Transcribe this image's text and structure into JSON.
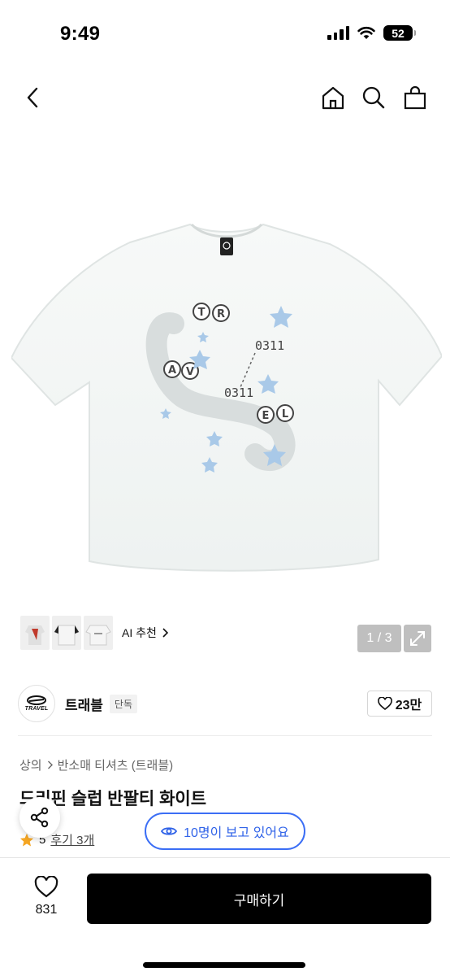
{
  "status_bar": {
    "time": "9:49",
    "battery": "52"
  },
  "nav": {
    "back_icon": "chevron-left-icon",
    "home_icon": "home-icon",
    "search_icon": "search-icon",
    "bag_icon": "shopping-bag-icon"
  },
  "gallery": {
    "ai_recommend_label": "AI 추천",
    "counter": "1 / 3",
    "print": {
      "letters": [
        "T",
        "R",
        "A",
        "V",
        "E",
        "L"
      ],
      "numbers": [
        "0311",
        "0311"
      ]
    }
  },
  "brand": {
    "logo_text": "TRAVEL",
    "name": "트래블",
    "tag": "단독",
    "likes": "23만"
  },
  "breadcrumb": {
    "category": "상의",
    "subcategory": "반소매 티셔츠 (트래블)"
  },
  "product": {
    "title": "드리핀 슬럽 반팔티 화이트",
    "rating": "5",
    "reviews": "후기 3개"
  },
  "viewers": {
    "text": "10명이 보고 있어요"
  },
  "bottom": {
    "wish_count": "831",
    "buy_label": "구매하기"
  },
  "colors": {
    "accent_blue": "#3b6ef5",
    "star": "#f5a623",
    "buy_button": "#000000"
  }
}
